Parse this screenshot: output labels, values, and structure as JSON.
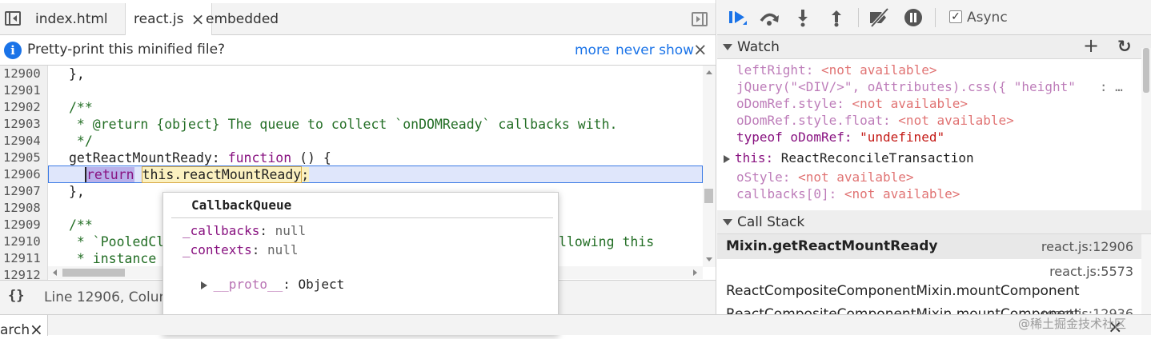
{
  "tabs": {
    "items": [
      "index.html",
      "react.js",
      "embedded"
    ],
    "close": "×"
  },
  "infobar": {
    "message": "Pretty-print this minified file?",
    "more": "more",
    "never_show": "never show",
    "close": "×"
  },
  "code": {
    "line_numbers": [
      "12900",
      "12901",
      "12902",
      "12903",
      "12904",
      "12905",
      "12906",
      "12907",
      "12908",
      "12909",
      "12910",
      "12911",
      "12912"
    ],
    "l12900": "},",
    "l12902": "/**",
    "l12903": " * @return {object} The queue to collect `onDOMReady` callbacks with.",
    "l12904": " */",
    "l12905_name": "getReactMountReady: ",
    "l12905_kw": "function",
    "l12905_rest": " () {",
    "l12906_kw": "return",
    "l12906_expr": "this.reactMountReady",
    "l12906_semi": ";",
    "l12907": "},",
    "l12909": "/**",
    "l12910_a": " * `PooledCl",
    "l12910_b": "llowing this",
    "l12911": " * instance"
  },
  "popup": {
    "title": "CallbackQueue",
    "props": [
      {
        "name": "_callbacks",
        "sep": ": ",
        "value": "null"
      },
      {
        "name": "_contexts",
        "sep": ": ",
        "value": "null"
      },
      {
        "name": "__proto__",
        "sep": ": ",
        "value": "Object"
      }
    ]
  },
  "status": {
    "braces": "{}",
    "position": "Line 12906, Colum"
  },
  "debugger": {
    "async_label": "Async",
    "async_checked": true
  },
  "watch": {
    "title": "Watch",
    "add": "+",
    "refresh": "↻",
    "items": [
      {
        "name": "leftRight",
        "value": "<not available>"
      },
      {
        "name": "jQuery(\"<DIV/>\", oAttributes).css({ \"height\"",
        "value": ": …"
      },
      {
        "name": "oDomRef.style",
        "value": "<not available>"
      },
      {
        "name": "oDomRef.style.float",
        "value": "<not available>"
      },
      {
        "name": "typeof oDomRef",
        "value": "\"undefined\""
      },
      {
        "name": "this",
        "value": "ReactReconcileTransaction"
      },
      {
        "name": "oStyle",
        "value": "<not available>"
      },
      {
        "name": "callbacks[0]",
        "value": "<not available>"
      }
    ]
  },
  "callstack": {
    "title": "Call Stack",
    "frames": [
      {
        "fn": "Mixin.getReactMountReady",
        "loc": "react.js:12906"
      },
      {
        "fn": "ReactCompositeComponentMixin.mountComponent",
        "loc": "react.js:5573"
      },
      {
        "fn": "ReactCompositeComponentMixin.mountComponent",
        "loc": "react.js:12936"
      }
    ]
  },
  "bottom": {
    "tab": "arch",
    "close": "×",
    "right_close": "×"
  },
  "watermark": "@稀土掘金技术社区",
  "colors": {
    "accent": "#1a73e8",
    "highlight": "#dfe6fb",
    "keyword": "#881280",
    "comment": "#236e25",
    "not_available": "#c80000"
  },
  "icons": [
    "panel-toggle-icon",
    "close-icon",
    "info-icon",
    "resume-icon",
    "step-over-icon",
    "step-into-icon",
    "step-out-icon",
    "deactivate-breakpoints-icon",
    "pause-on-exceptions-icon",
    "plus-icon",
    "refresh-icon",
    "triangle-down-icon",
    "triangle-right-icon"
  ]
}
